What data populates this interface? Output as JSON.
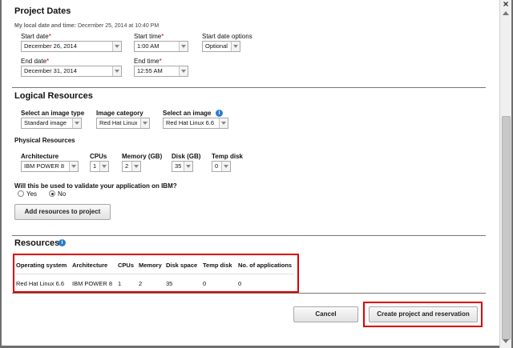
{
  "close_symbol": "×",
  "project_dates": {
    "title": "Project Dates",
    "local_label": "My local date and time:",
    "local_value": "December 25, 2014 at 10:40 PM",
    "start_date": {
      "label": "Start date",
      "value": "December 26, 2014"
    },
    "start_time": {
      "label": "Start time",
      "value": "1:00 AM"
    },
    "start_options": {
      "label": "Start date options",
      "value": "Optional"
    },
    "end_date": {
      "label": "End date",
      "value": "December 31, 2014"
    },
    "end_time": {
      "label": "End time",
      "value": "12:55 AM"
    },
    "required_mark": "*"
  },
  "logical": {
    "title": "Logical Resources",
    "image_type": {
      "label": "Select an image type",
      "value": "Standard image"
    },
    "image_category": {
      "label": "Image category",
      "value": "Red Hat Linux"
    },
    "image": {
      "label": "Select an image",
      "value": "Red Hat Linux 6.6"
    },
    "info_symbol": "i"
  },
  "physical": {
    "title": "Physical Resources",
    "architecture": {
      "label": "Architecture",
      "value": "IBM POWER 8"
    },
    "cpus": {
      "label": "CPUs",
      "value": "1"
    },
    "memory": {
      "label": "Memory (GB)",
      "value": "2"
    },
    "disk": {
      "label": "Disk (GB)",
      "value": "35"
    },
    "temp_disk": {
      "label": "Temp disk",
      "value": "0"
    }
  },
  "validate": {
    "question": "Will this be used to validate your application on IBM?",
    "yes": "Yes",
    "no": "No"
  },
  "add_button": "Add resources to project",
  "resources": {
    "title": "Resources",
    "columns": [
      "Operating system",
      "Architecture",
      "CPUs",
      "Memory",
      "Disk space",
      "Temp disk",
      "No. of applications"
    ],
    "row": [
      "Red Hat Linux 6.6",
      "IBM POWER 8",
      "1",
      "2",
      "35",
      "0",
      "0"
    ]
  },
  "footer": {
    "cancel": "Cancel",
    "create": "Create project and reservation"
  },
  "colors": {
    "highlight": "#dd0000",
    "info": "#2b7bd3"
  }
}
